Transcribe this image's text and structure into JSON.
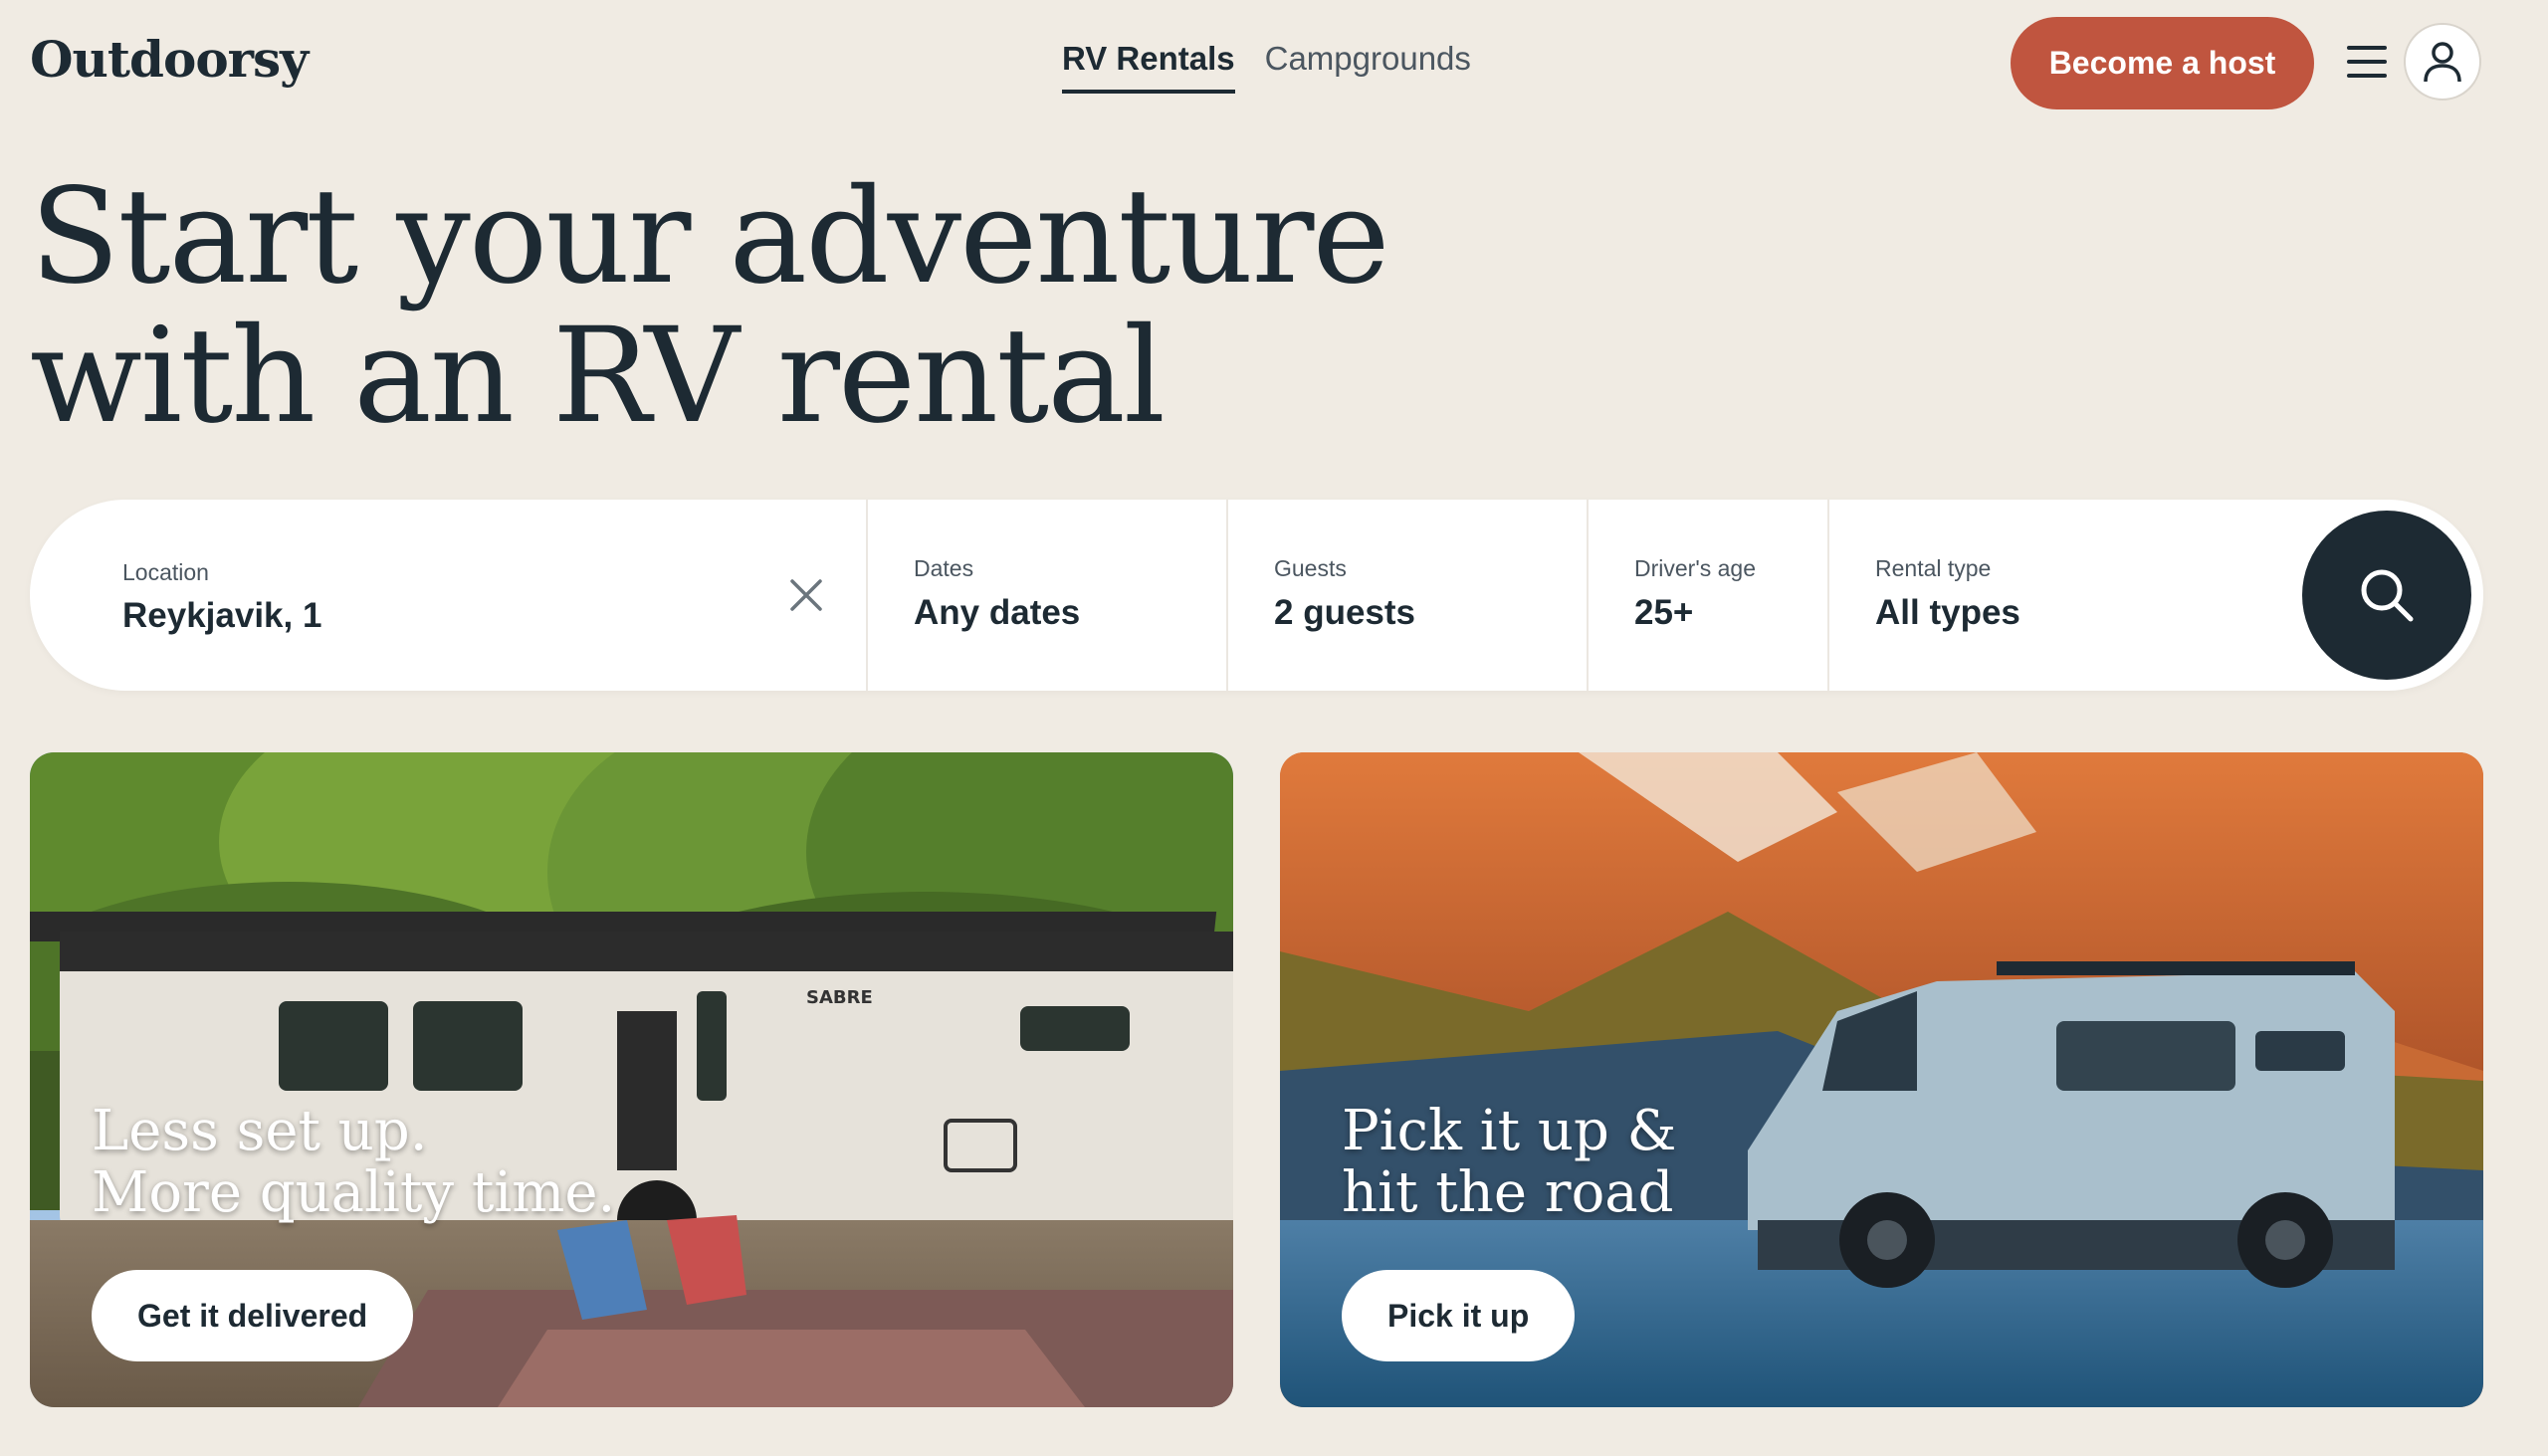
{
  "header": {
    "logo": "Outdoorsy",
    "tabs": [
      {
        "label": "RV Rentals",
        "active": true
      },
      {
        "label": "Campgrounds",
        "active": false
      }
    ],
    "host_button": "Become a host",
    "menu_icon": "hamburger-menu-icon",
    "avatar_icon": "user-icon"
  },
  "hero": {
    "line1": "Start your adventure",
    "line2": "with an RV rental"
  },
  "search": {
    "location": {
      "label": "Location",
      "value": "Reykjavik, 1"
    },
    "dates": {
      "label": "Dates",
      "value": "Any dates"
    },
    "guests": {
      "label": "Guests",
      "value": "2 guests"
    },
    "drivers_age": {
      "label": "Driver's age",
      "value": "25+"
    },
    "rental_type": {
      "label": "Rental type",
      "value": "All types"
    },
    "clear_icon": "close-icon",
    "search_icon": "search-icon"
  },
  "cards": [
    {
      "title_line1": "Less set up.",
      "title_line2": "More quality time.",
      "button": "Get it delivered"
    },
    {
      "title_line1": "Pick it up &",
      "title_line2": "hit the road",
      "button": "Pick it up"
    }
  ],
  "colors": {
    "background": "#f0ebe3",
    "accent": "#c0553f",
    "dark": "#1d2a33"
  }
}
